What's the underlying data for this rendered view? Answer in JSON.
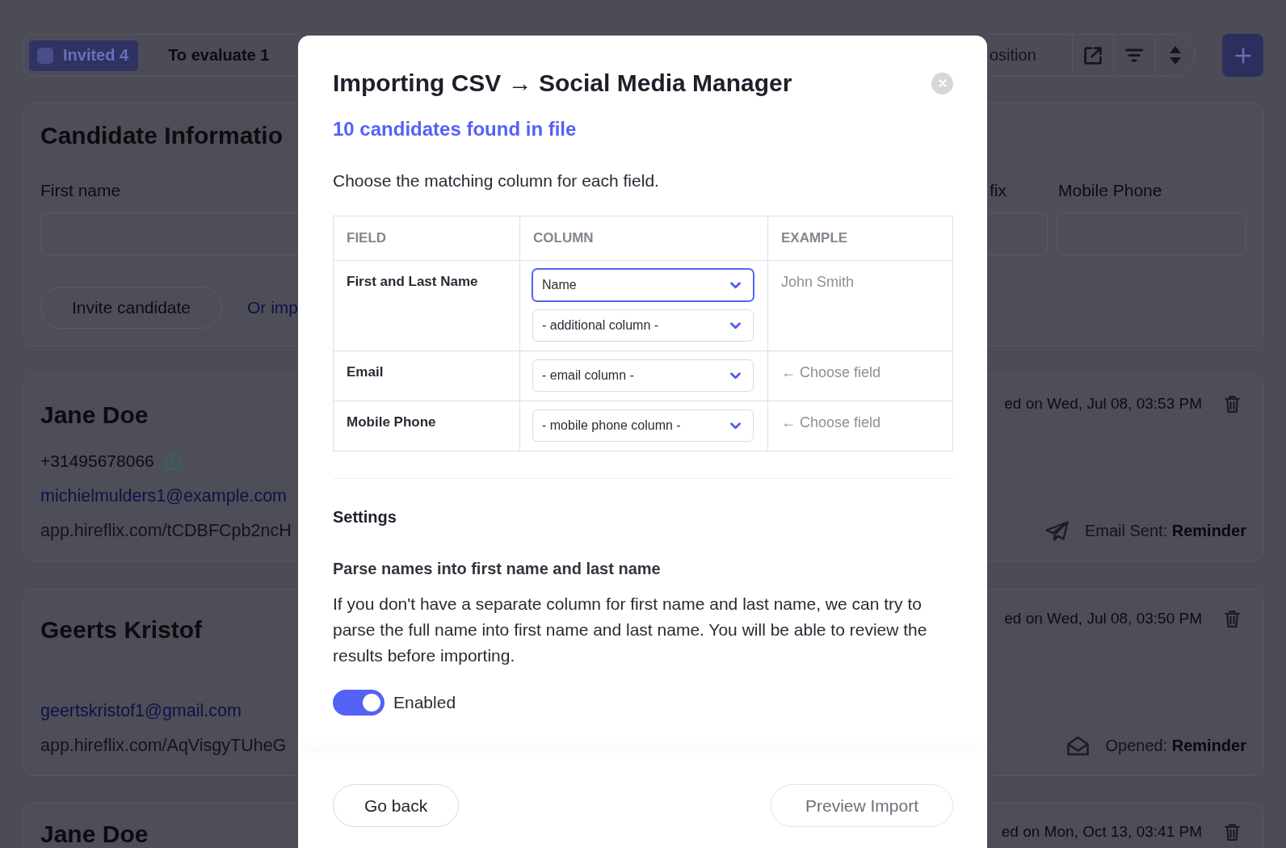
{
  "toolbar": {
    "status_tabs": [
      {
        "label": "Invited 4",
        "selected": true
      },
      {
        "label": "To evaluate 1",
        "selected": false
      }
    ],
    "search": {
      "placeholder": "osition"
    }
  },
  "candidate_form": {
    "title": "Candidate Informatio",
    "left_fields": [
      {
        "label": "First name"
      }
    ],
    "right_fields": [
      {
        "label": "fix"
      },
      {
        "label": "Mobile Phone"
      }
    ],
    "invite_button": "Invite candidate",
    "import_link": "Or imp"
  },
  "candidates": [
    {
      "name": "Jane Doe",
      "phone": {
        "number": "+31495678066",
        "chat_enabled": true
      },
      "email": "michielmulders1@example.com",
      "link": "app.hireflix.com/tCDBFCpb2ncH",
      "invited": "ed on Wed, Jul 08, 03:53 PM",
      "activity": {
        "kind": "sent",
        "text": "Email Sent: **Reminder**"
      }
    },
    {
      "name": "Geerts Kristof",
      "email": "geertskristof1@gmail.com",
      "link": "app.hireflix.com/AqVisgyTUheG",
      "invited": "ed on Wed, Jul 08, 03:50 PM",
      "activity": {
        "kind": "opened",
        "text": "Opened: **Reminder**"
      }
    },
    {
      "name": "Jane Doe",
      "invited": "ed on Mon, Oct 13, 03:41 PM"
    }
  ],
  "import_dialog": {
    "title": "Importing CSV → Social Media Manager",
    "subtitle": "10 candidates found in file",
    "instruction": "Choose the matching column for each field.",
    "mapping_table": {
      "columns": [
        "FIELD",
        "COLUMN",
        "EXAMPLE"
      ],
      "rows": [
        {
          "field": "First and Last Name",
          "selects": [
            {
              "value": "Name",
              "focused": true
            },
            {
              "value": "- additional column -",
              "focused": false
            }
          ],
          "example": "John Smith"
        },
        {
          "field": "Email",
          "selects": [
            {
              "value": "- email column -",
              "focused": false
            }
          ],
          "example": "← Choose field"
        },
        {
          "field": "Mobile Phone",
          "selects": [
            {
              "value": "- mobile phone column -",
              "focused": false
            }
          ],
          "example": "← Choose field"
        }
      ]
    },
    "settings_title": "Settings",
    "settings": [
      {
        "title": "Parse names into first name and last name",
        "description": "If you don't have a separate column for first name and last name, we can try to parse the full name into first name and last name. You will be able to review the results before importing.",
        "toggle": {
          "on": true,
          "label": "Enabled"
        }
      }
    ],
    "buttons": [
      {
        "label": "Go back",
        "disabled": false
      },
      {
        "label": "Preview Import",
        "disabled": true
      }
    ]
  }
}
